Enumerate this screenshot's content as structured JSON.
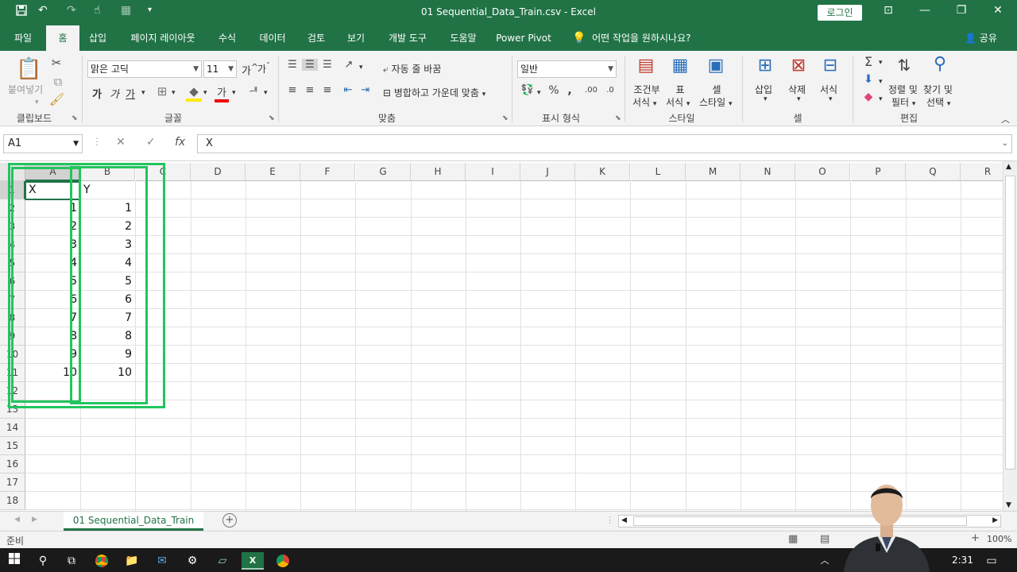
{
  "title_bar": {
    "title": "01 Sequential_Data_Train.csv  -  Excel",
    "login_label": "로그인"
  },
  "tabs": [
    "파일",
    "홈",
    "삽입",
    "페이지 레이아웃",
    "수식",
    "데이터",
    "검토",
    "보기",
    "개발 도구",
    "도움말",
    "Power Pivot"
  ],
  "tell_me": "어떤 작업을 원하시나요?",
  "share_label": "공유",
  "ribbon": {
    "clipboard": {
      "label": "클립보드",
      "paste": "붙여넣기"
    },
    "font": {
      "label": "글꼴",
      "font_name": "맑은 고딕",
      "font_size": "11",
      "bold": "가",
      "italic": "가",
      "underline": "가",
      "grow": "가",
      "shrink": "가"
    },
    "alignment": {
      "label": "맞춤",
      "wrap": "자동 줄 바꿈",
      "merge": "병합하고 가운데 맞춤"
    },
    "number": {
      "label": "표시 형식",
      "format": "일반"
    },
    "styles": {
      "label": "스타일",
      "conditional": [
        "조건부",
        "서식"
      ],
      "table": [
        "표",
        "서식"
      ],
      "cell_style": [
        "셀",
        "스타일"
      ]
    },
    "cells": {
      "label": "셀",
      "insert": "삽입",
      "delete": "삭제",
      "format": "서식"
    },
    "editing": {
      "label": "편집",
      "sort": [
        "정렬 및",
        "필터"
      ],
      "find": [
        "찾기 및",
        "선택"
      ]
    }
  },
  "formula_bar": {
    "name_box": "A1",
    "formula": "X"
  },
  "columns": [
    "A",
    "B",
    "C",
    "D",
    "E",
    "F",
    "G",
    "H",
    "I",
    "J",
    "K",
    "L",
    "M",
    "N",
    "O",
    "P",
    "Q",
    "R"
  ],
  "rows": [
    "1",
    "2",
    "3",
    "4",
    "5",
    "6",
    "7",
    "8",
    "9",
    "10",
    "11",
    "12",
    "13",
    "14",
    "15",
    "16",
    "17",
    "18"
  ],
  "sheet_data": {
    "header": [
      "X",
      "Y"
    ],
    "rows": [
      [
        "1",
        "1"
      ],
      [
        "2",
        "2"
      ],
      [
        "3",
        "3"
      ],
      [
        "4",
        "4"
      ],
      [
        "5",
        "5"
      ],
      [
        "6",
        "6"
      ],
      [
        "7",
        "7"
      ],
      [
        "8",
        "8"
      ],
      [
        "9",
        "9"
      ],
      [
        "10",
        "10"
      ]
    ]
  },
  "sheet_tab": "01 Sequential_Data_Train",
  "status": {
    "ready": "준비",
    "zoom": "100%"
  },
  "taskbar": {
    "time": "2:31"
  },
  "colors": {
    "excel_green": "#217346",
    "annotation": "#22c55e"
  }
}
